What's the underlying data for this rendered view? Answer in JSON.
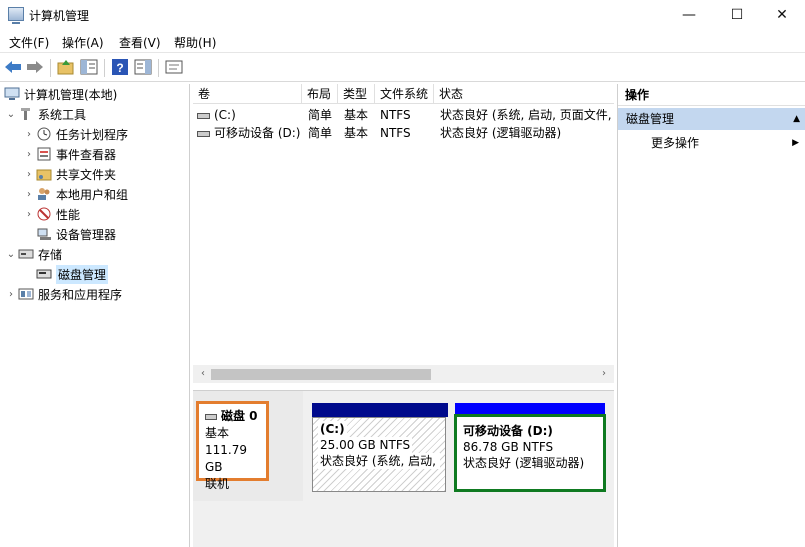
{
  "window": {
    "title": "计算机管理",
    "minimize": "—",
    "maximize": "☐",
    "close": "✕"
  },
  "menu": [
    "文件(F)",
    "操作(A)",
    "查看(V)",
    "帮助(H)"
  ],
  "tree": {
    "root": "计算机管理(本地)",
    "system_tools": "系统工具",
    "task_scheduler": "任务计划程序",
    "event_viewer": "事件查看器",
    "shared_folders": "共享文件夹",
    "local_users": "本地用户和组",
    "performance": "性能",
    "device_manager": "设备管理器",
    "storage": "存储",
    "disk_management": "磁盘管理",
    "services_apps": "服务和应用程序"
  },
  "columns": {
    "volume": "卷",
    "layout": "布局",
    "type": "类型",
    "fs": "文件系统",
    "status": "状态"
  },
  "volumes": [
    {
      "name": "(C:)",
      "layout": "简单",
      "type": "基本",
      "fs": "NTFS",
      "status": "状态良好 (系统, 启动, 页面文件,"
    },
    {
      "name": "可移动设备 (D:)",
      "layout": "简单",
      "type": "基本",
      "fs": "NTFS",
      "status": "状态良好 (逻辑驱动器)"
    }
  ],
  "disk": {
    "name": "磁盘 0",
    "kind": "基本",
    "size": "111.79 GB",
    "state": "联机",
    "partitions": [
      {
        "label": "(C:)",
        "size": "25.00 GB NTFS",
        "status": "状态良好 (系统, 启动, 页"
      },
      {
        "label": "可移动设备  (D:)",
        "size": "86.78 GB NTFS",
        "status": "状态良好 (逻辑驱动器)"
      }
    ]
  },
  "actions": {
    "title": "操作",
    "section": "磁盘管理",
    "more": "更多操作"
  },
  "colors": {
    "highlight_disk": "#e37d2f",
    "highlight_partition": "#0f7a21",
    "primary_partition": "#000a8c",
    "logical_partition": "#0000ff",
    "selection": "#cce8ff",
    "action_section": "#c3d7ef"
  }
}
